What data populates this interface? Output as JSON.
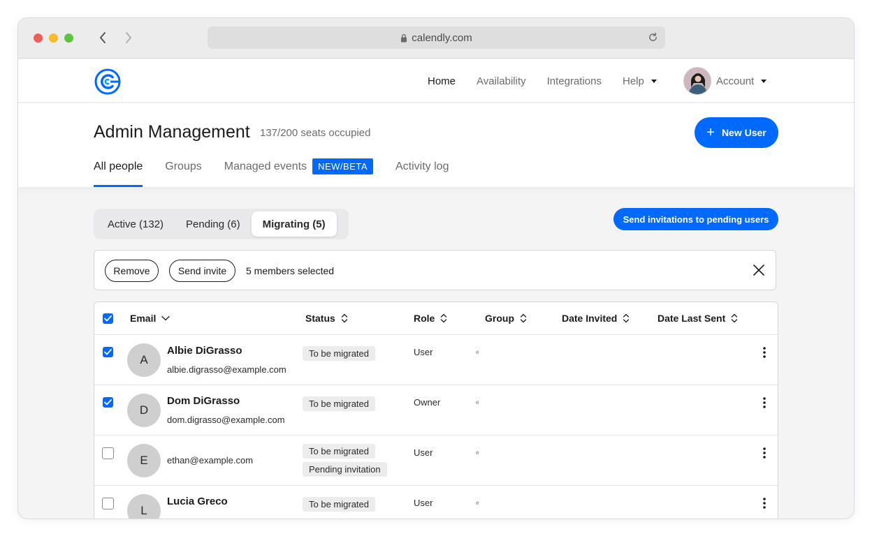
{
  "browser": {
    "url": "calendly.com"
  },
  "nav": {
    "links": [
      {
        "label": "Home"
      },
      {
        "label": "Availability"
      },
      {
        "label": "Integrations"
      },
      {
        "label": "Help"
      }
    ],
    "account_label": "Account"
  },
  "header": {
    "title": "Admin Management",
    "seats": "137/200 seats occupied",
    "new_user_label": "New User",
    "tabs": [
      {
        "label": "All people"
      },
      {
        "label": "Groups"
      },
      {
        "label": "Managed events",
        "badge": "NEW/BETA"
      },
      {
        "label": "Activity log"
      }
    ]
  },
  "segments": [
    {
      "label": "Active (132)"
    },
    {
      "label": "Pending (6)"
    },
    {
      "label": "Migrating (5)"
    }
  ],
  "send_invitations_label": "Send invitations to pending users",
  "selection": {
    "remove_label": "Remove",
    "send_invite_label": "Send invite",
    "count_text": "5 members selected"
  },
  "table": {
    "columns": [
      "Email",
      "Status",
      "Role",
      "Group",
      "Date Invited",
      "Date Last Sent"
    ],
    "rows": [
      {
        "initial": "A",
        "name": "Albie DiGrasso",
        "email": "albie.digrasso@example.com",
        "statuses": [
          "To be migrated"
        ],
        "role": "User",
        "group": "e",
        "checked": true
      },
      {
        "initial": "D",
        "name": "Dom DiGrasso",
        "email": "dom.digrasso@example.com",
        "statuses": [
          "To be migrated"
        ],
        "role": "Owner",
        "group": "e",
        "checked": true
      },
      {
        "initial": "E",
        "name": "",
        "email": "ethan@example.com",
        "statuses": [
          "To be migrated",
          "Pending invitation"
        ],
        "role": "User",
        "group": "e",
        "checked": false
      },
      {
        "initial": "L",
        "name": "Lucia Greco",
        "email": "",
        "statuses": [
          "To be migrated"
        ],
        "role": "User",
        "group": "e",
        "checked": false
      }
    ]
  },
  "colors": {
    "accent": "#0069ff",
    "tag_bg": "#ececec",
    "avatar_bg": "#cfcfcf"
  }
}
